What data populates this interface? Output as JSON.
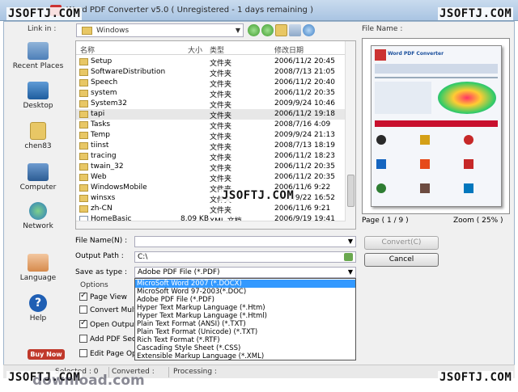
{
  "window": {
    "title": "Word PDF Converter v5.0 ( Unregistered - 1 days remaining )"
  },
  "watermark": "JSOFTJ.COM",
  "watermark_bottom": "download.com",
  "places": {
    "label": "Link in :",
    "items": [
      {
        "label": "Recent Places",
        "icon": "recent-places-icon"
      },
      {
        "label": "Desktop",
        "icon": "desktop-icon"
      },
      {
        "label": "chen83",
        "icon": "user-folder-icon"
      },
      {
        "label": "Computer",
        "icon": "computer-icon"
      },
      {
        "label": "Network",
        "icon": "network-icon"
      },
      {
        "label": "Language",
        "icon": "language-icon"
      },
      {
        "label": "Help",
        "icon": "help-icon"
      }
    ],
    "buy_now": "Buy Now"
  },
  "location": {
    "value": "Windows"
  },
  "filelist": {
    "headers": {
      "name": "名称",
      "size": "大小",
      "type": "类型",
      "modified": "修改日期"
    },
    "rows": [
      {
        "name": "Setup",
        "size": "",
        "type": "文件夹",
        "date": "2006/11/2 20:45"
      },
      {
        "name": "SoftwareDistribution",
        "size": "",
        "type": "文件夹",
        "date": "2008/7/13 21:05"
      },
      {
        "name": "Speech",
        "size": "",
        "type": "文件夹",
        "date": "2006/11/2 20:40"
      },
      {
        "name": "system",
        "size": "",
        "type": "文件夹",
        "date": "2006/11/2 20:35"
      },
      {
        "name": "System32",
        "size": "",
        "type": "文件夹",
        "date": "2009/9/24 10:46"
      },
      {
        "name": "tapi",
        "size": "",
        "type": "文件夹",
        "date": "2006/11/2 19:18"
      },
      {
        "name": "Tasks",
        "size": "",
        "type": "文件夹",
        "date": "2008/7/16 4:09"
      },
      {
        "name": "Temp",
        "size": "",
        "type": "文件夹",
        "date": "2009/9/24 21:13"
      },
      {
        "name": "tiinst",
        "size": "",
        "type": "文件夹",
        "date": "2008/7/13 18:19"
      },
      {
        "name": "tracing",
        "size": "",
        "type": "文件夹",
        "date": "2006/11/2 18:23"
      },
      {
        "name": "twain_32",
        "size": "",
        "type": "文件夹",
        "date": "2006/11/2 20:35"
      },
      {
        "name": "Web",
        "size": "",
        "type": "文件夹",
        "date": "2006/11/2 20:35"
      },
      {
        "name": "WindowsMobile",
        "size": "",
        "type": "文件夹",
        "date": "2006/11/6 9:22"
      },
      {
        "name": "winsxs",
        "size": "",
        "type": "文件夹",
        "date": "2009/9/22 16:52"
      },
      {
        "name": "zh-CN",
        "size": "",
        "type": "文件夹",
        "date": "2006/11/6 9:21"
      },
      {
        "name": "HomeBasic",
        "size": "8.09 KB",
        "type": "XML 文档",
        "date": "2006/9/19 19:41"
      }
    ],
    "selected_index": 5
  },
  "preview": {
    "label": "File Name :",
    "page": "Page ( 1 / 9 )",
    "zoom": "Zoom ( 25% )",
    "doc_title": "Word PDF Converter"
  },
  "form": {
    "file_name_label": "File Name(N) :",
    "file_name_value": "",
    "output_path_label": "Output Path :",
    "output_path_value": "C:\\",
    "save_as_label": "Save as type :",
    "save_as_value": "Adobe PDF File (*.PDF)",
    "convert_label": "Convert(C)",
    "cancel_label": "Cancel"
  },
  "options": {
    "label": "Options",
    "items": [
      {
        "label": "Page View",
        "checked": true
      },
      {
        "label": "Convert MultiSe",
        "checked": false
      },
      {
        "label": "Open Output P",
        "checked": true
      },
      {
        "label": "Add PDF Secu",
        "checked": false
      },
      {
        "label": "Edit Page Optio",
        "checked": false
      }
    ]
  },
  "save_as_options": [
    "MicroSoft Word 2007 (*.DOCX)",
    "MicroSoft Word 97-2003(*.DOC)",
    "Adobe PDF File (*.PDF)",
    "Hyper Text Markup Language (*.Htm)",
    "Hyper Text Markup Language (*.Html)",
    "Plain Text Format (ANSI) (*.TXT)",
    "Plain Text Format (Unicode) (*.TXT)",
    "Rich Text Format (*.RTF)",
    "Cascading Style Sheet (*.CSS)",
    "Extensible Markup Language (*.XML)"
  ],
  "status": {
    "selected": "Selected : 0",
    "converted": "Converted :",
    "processing": "Processing :"
  },
  "colors": {
    "highlight": "#3399ff",
    "folder": "#e8c765"
  }
}
